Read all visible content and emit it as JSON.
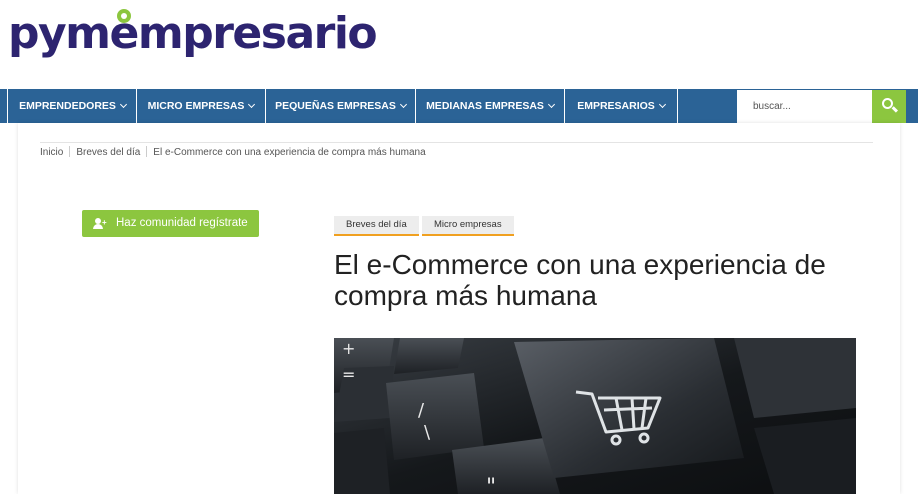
{
  "header": {
    "logo_prefix": "pym",
    "logo_e": "e",
    "logo_suffix": "mpresario"
  },
  "nav": {
    "items": [
      {
        "label": "EMPRENDEDORES"
      },
      {
        "label": "MICRO EMPRESAS"
      },
      {
        "label": "PEQUEÑAS EMPRESAS"
      },
      {
        "label": "MEDIANAS EMPRESAS"
      },
      {
        "label": "EMPRESARIOS"
      }
    ],
    "search_placeholder": "buscar..."
  },
  "breadcrumb": {
    "items": [
      "Inicio",
      "Breves del día",
      "El e-Commerce con una experiencia de compra más humana"
    ]
  },
  "sidebar": {
    "register_label": "Haz comunidad regístrate"
  },
  "article": {
    "tags": [
      "Breves del día",
      "Micro empresas"
    ],
    "title": "El e-Commerce con una experiencia de compra más humana",
    "hero_icon": "shopping-cart-icon"
  },
  "colors": {
    "nav_bg": "#2b6396",
    "accent_green": "#8cc63f",
    "logo_purple": "#2d2470",
    "tag_underline": "#f0a020"
  }
}
